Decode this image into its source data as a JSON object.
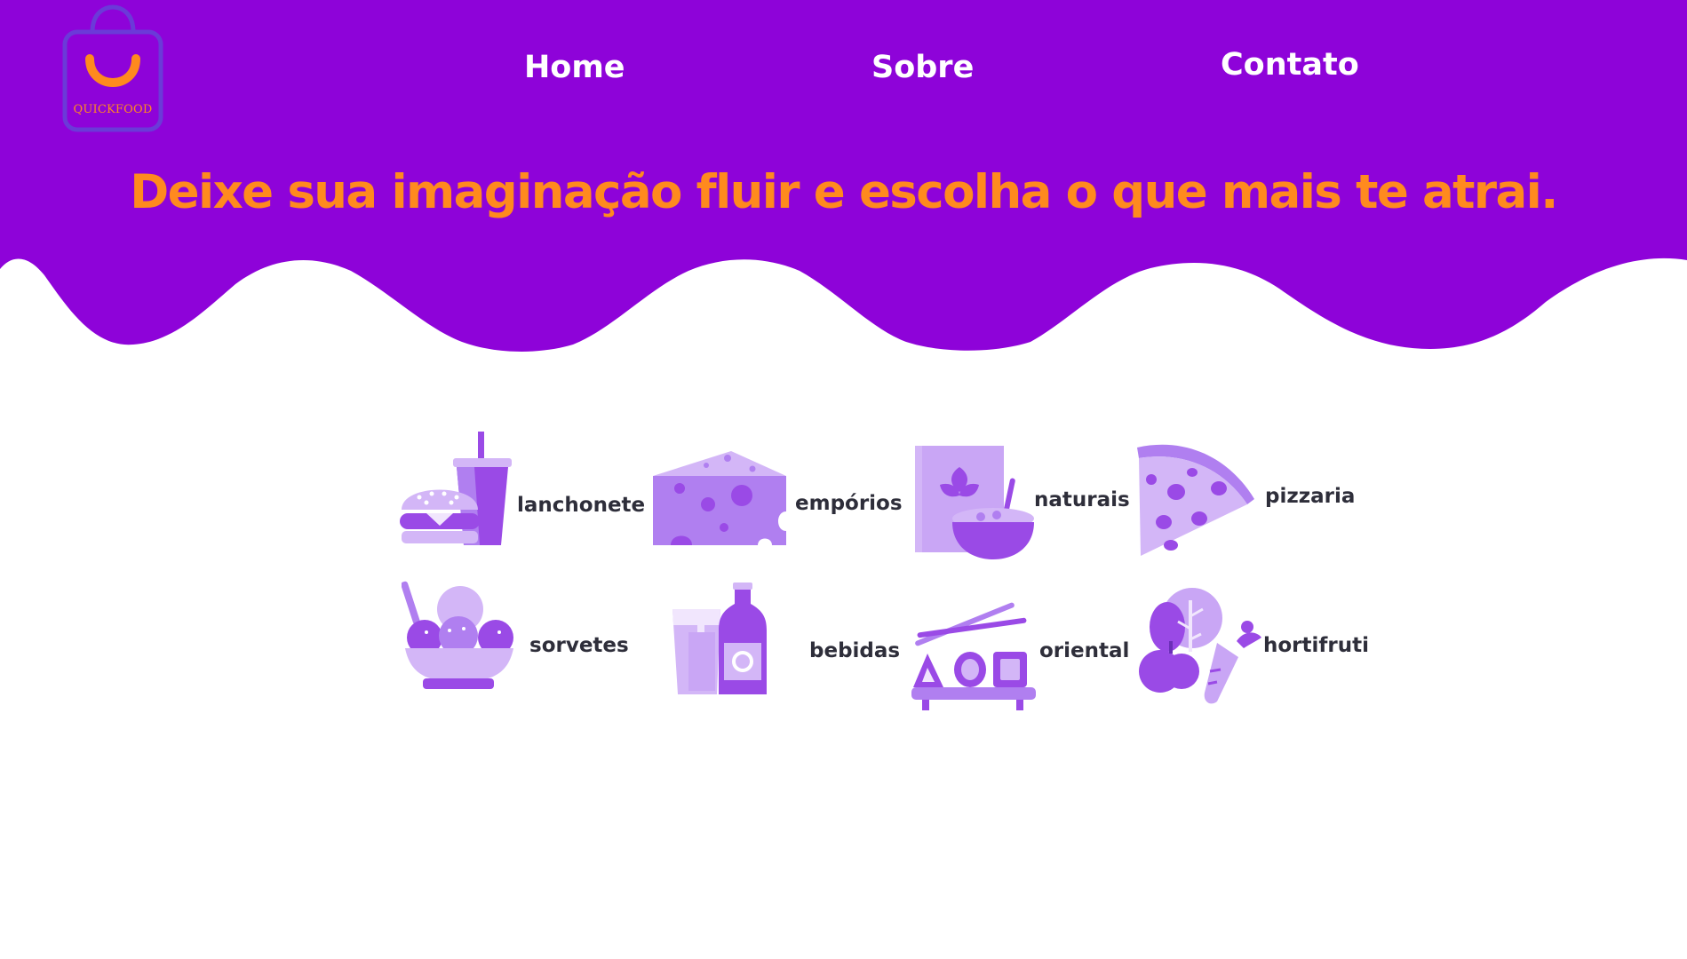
{
  "brand": {
    "logo_text": "QUICKFOOD",
    "logo_icon": "shopping-bag-smile-icon"
  },
  "nav": {
    "home": "Home",
    "sobre": "Sobre",
    "contato": "Contato"
  },
  "hero": {
    "headline": "Deixe sua imaginação fluir e escolha o que mais te atrai."
  },
  "categories": [
    {
      "label": "lanchonete",
      "icon": "burger-drink-icon"
    },
    {
      "label": "empórios",
      "icon": "cheese-icon"
    },
    {
      "label": "naturais",
      "icon": "cereal-bowl-icon"
    },
    {
      "label": "pizzaria",
      "icon": "pizza-slice-icon"
    },
    {
      "label": "sorvetes",
      "icon": "ice-cream-bowl-icon"
    },
    {
      "label": "bebidas",
      "icon": "beer-bottle-icon"
    },
    {
      "label": "oriental",
      "icon": "sushi-chopsticks-icon"
    },
    {
      "label": "hortifruti",
      "icon": "fruits-vegetables-icon"
    }
  ],
  "colors": {
    "primary_purple": "#8e03d9",
    "accent_orange": "#ff8a1e",
    "icon_dark": "#9a4ae6",
    "icon_mid": "#b07ff0",
    "icon_light": "#d3b6f7",
    "label_text": "#2e2e3a"
  }
}
